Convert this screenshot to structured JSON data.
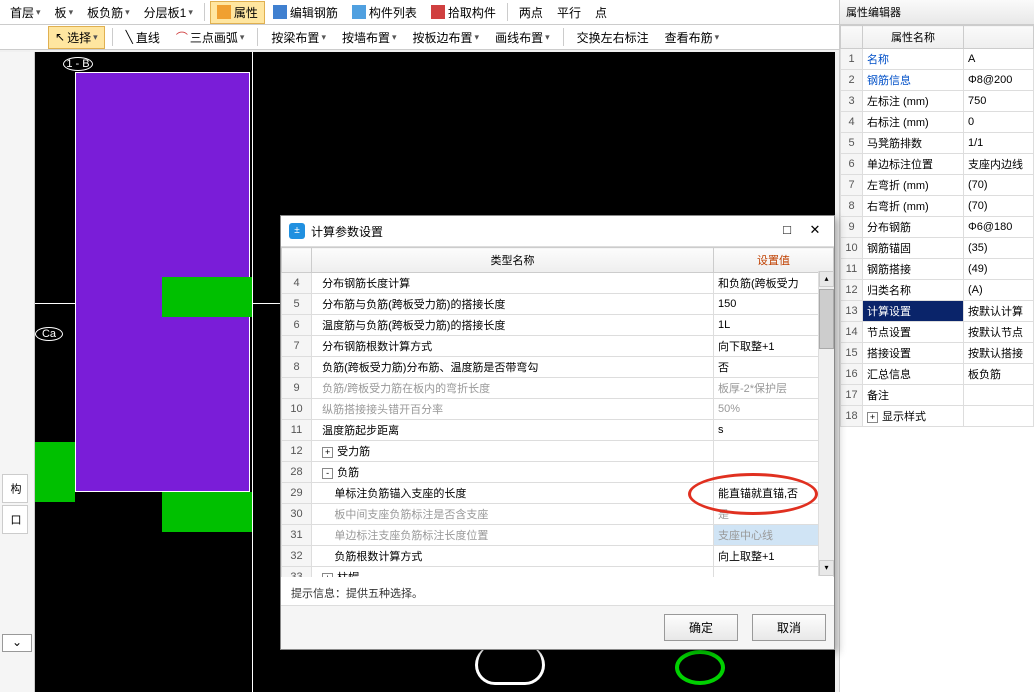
{
  "toolbar1": {
    "floor": "首层",
    "board": "板",
    "neg": "板负筋",
    "layer": "分层板1",
    "attr": "属性",
    "edit": "编辑钢筋",
    "list": "构件列表",
    "pick": "拾取构件",
    "two": "两点",
    "parallel": "平行",
    "point": "点"
  },
  "toolbar2": {
    "select": "选择",
    "line": "直线",
    "arc": "三点画弧",
    "byBeam": "按梁布置",
    "byWall": "按墙布置",
    "byEdge": "按板边布置",
    "drawLine": "画线布置",
    "swap": "交换左右标注",
    "view": "查看布筋"
  },
  "canvas": {
    "labelB": "1 - B",
    "labelCa": "Ca"
  },
  "propPanel": {
    "title": "属性编辑器",
    "header": "属性名称",
    "rows": [
      {
        "n": "1",
        "name": "名称",
        "val": "A",
        "link": true
      },
      {
        "n": "2",
        "name": "钢筋信息",
        "val": "Φ8@200",
        "link": true
      },
      {
        "n": "3",
        "name": "左标注 (mm)",
        "val": "750"
      },
      {
        "n": "4",
        "name": "右标注 (mm)",
        "val": "0"
      },
      {
        "n": "5",
        "name": "马凳筋排数",
        "val": "1/1"
      },
      {
        "n": "6",
        "name": "单边标注位置",
        "val": "支座内边线"
      },
      {
        "n": "7",
        "name": "左弯折 (mm)",
        "val": "(70)"
      },
      {
        "n": "8",
        "name": "右弯折 (mm)",
        "val": "(70)"
      },
      {
        "n": "9",
        "name": "分布钢筋",
        "val": "Φ6@180"
      },
      {
        "n": "10",
        "name": "钢筋锚固",
        "val": "(35)"
      },
      {
        "n": "11",
        "name": "钢筋搭接",
        "val": "(49)"
      },
      {
        "n": "12",
        "name": "归类名称",
        "val": "(A)"
      },
      {
        "n": "13",
        "name": "计算设置",
        "val": "按默认计算",
        "hl": true
      },
      {
        "n": "14",
        "name": "节点设置",
        "val": "按默认节点"
      },
      {
        "n": "15",
        "name": "搭接设置",
        "val": "按默认搭接"
      },
      {
        "n": "16",
        "name": "汇总信息",
        "val": "板负筋"
      },
      {
        "n": "17",
        "name": "备注",
        "val": ""
      },
      {
        "n": "18",
        "name": "显示样式",
        "val": "",
        "exp": "+"
      }
    ]
  },
  "dialog": {
    "title": "计算参数设置",
    "colType": "类型名称",
    "colVal": "设置值",
    "rows": [
      {
        "n": "4",
        "name": "分布钢筋长度计算",
        "val": "和负筋(跨板受力"
      },
      {
        "n": "5",
        "name": "分布筋与负筋(跨板受力筋)的搭接长度",
        "val": "150"
      },
      {
        "n": "6",
        "name": "温度筋与负筋(跨板受力筋)的搭接长度",
        "val": "1L"
      },
      {
        "n": "7",
        "name": "分布钢筋根数计算方式",
        "val": "向下取整+1"
      },
      {
        "n": "8",
        "name": "负筋(跨板受力筋)分布筋、温度筋是否带弯勾",
        "val": "否"
      },
      {
        "n": "9",
        "name": "负筋/跨板受力筋在板内的弯折长度",
        "val": "板厚-2*保护层",
        "gray": true
      },
      {
        "n": "10",
        "name": "纵筋搭接接头错开百分率",
        "val": "50%",
        "gray": true
      },
      {
        "n": "11",
        "name": "温度筋起步距离",
        "val": "s"
      },
      {
        "n": "12",
        "name": "受力筋",
        "exp": "+"
      },
      {
        "n": "28",
        "name": "负筋",
        "exp": "-"
      },
      {
        "n": "29",
        "name": "单标注负筋锚入支座的长度",
        "val": "能直锚就直锚,否",
        "indent": true
      },
      {
        "n": "30",
        "name": "板中间支座负筋标注是否含支座",
        "val": "是",
        "indent": true,
        "gray": true
      },
      {
        "n": "31",
        "name": "单边标注支座负筋标注长度位置",
        "val": "支座中心线",
        "indent": true,
        "gray": true,
        "sel": true
      },
      {
        "n": "32",
        "name": "负筋根数计算方式",
        "val": "向上取整+1",
        "indent": true
      },
      {
        "n": "33",
        "name": "柱帽",
        "exp": "+"
      }
    ],
    "hint": "提示信息：提供五种选择。",
    "ok": "确定",
    "cancel": "取消"
  }
}
